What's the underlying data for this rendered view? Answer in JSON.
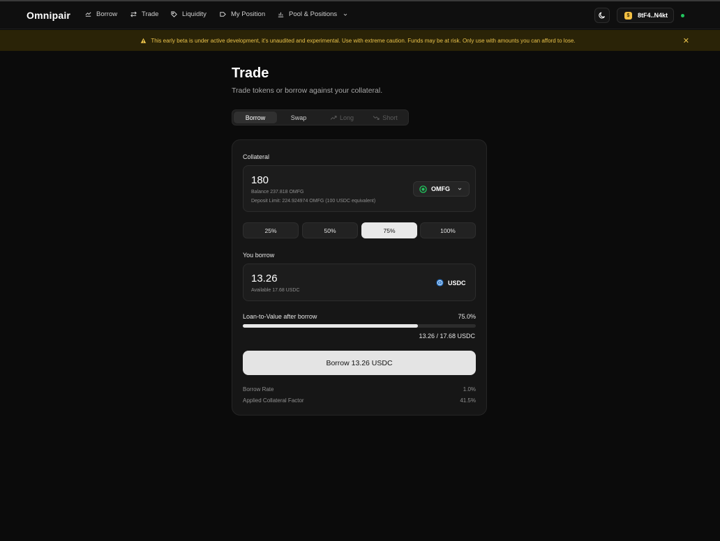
{
  "app": {
    "name": "Omnipair"
  },
  "nav": {
    "items": [
      {
        "label": "Borrow",
        "icon": "borrow-icon"
      },
      {
        "label": "Trade",
        "icon": "swap-arrows-icon"
      },
      {
        "label": "Liquidity",
        "icon": "tag-icon"
      },
      {
        "label": "My Position",
        "icon": "position-icon"
      },
      {
        "label": "Pool & Positions",
        "icon": "chart-bar-icon"
      }
    ]
  },
  "wallet": {
    "address": "8tF4..N4kt",
    "status_color": "#22c55e"
  },
  "banner": {
    "text": "This early beta is under active development, it's unaudited and experimental. Use with extreme caution. Funds may be at risk. Only use with amounts you can afford to lose.",
    "icon": "warning-icon",
    "color": "#e8c14a"
  },
  "page": {
    "title": "Trade",
    "subtitle": "Trade tokens or borrow against your collateral."
  },
  "tabs": [
    {
      "label": "Borrow",
      "state": "active"
    },
    {
      "label": "Swap",
      "state": "normal"
    },
    {
      "label": "Long",
      "state": "disabled",
      "icon": "trend-up-icon"
    },
    {
      "label": "Short",
      "state": "disabled",
      "icon": "trend-down-icon"
    }
  ],
  "collateral": {
    "label": "Collateral",
    "value": "180",
    "balance": "Balance 237.818 OMFG",
    "deposit_limit": "Deposit Limit: 224.924974 OMFG (100 USDC equivalent)",
    "token": "OMFG",
    "token_color": "#22c55e"
  },
  "percent_buttons": [
    {
      "label": "25%",
      "selected": false
    },
    {
      "label": "50%",
      "selected": false
    },
    {
      "label": "75%",
      "selected": true
    },
    {
      "label": "100%",
      "selected": false
    }
  ],
  "borrow": {
    "label": "You borrow",
    "value": "13.26",
    "available": "Available 17.68 USDC",
    "token": "USDC",
    "token_color": "#2775ca"
  },
  "ltv": {
    "label": "Loan-to-Value after borrow",
    "value_text": "75.0%",
    "fraction": 0.75,
    "ratio_text": "13.26 / 17.68 USDC"
  },
  "action": {
    "label": "Borrow 13.26 USDC"
  },
  "stats": [
    {
      "label": "Borrow Rate",
      "value": "1.0%"
    },
    {
      "label": "Applied Collateral Factor",
      "value": "41.5%"
    }
  ],
  "colors": {
    "background": "#0b0b0b",
    "card": "#161616",
    "accent": "#e4e4e4",
    "warning_bg": "#2a2307"
  }
}
